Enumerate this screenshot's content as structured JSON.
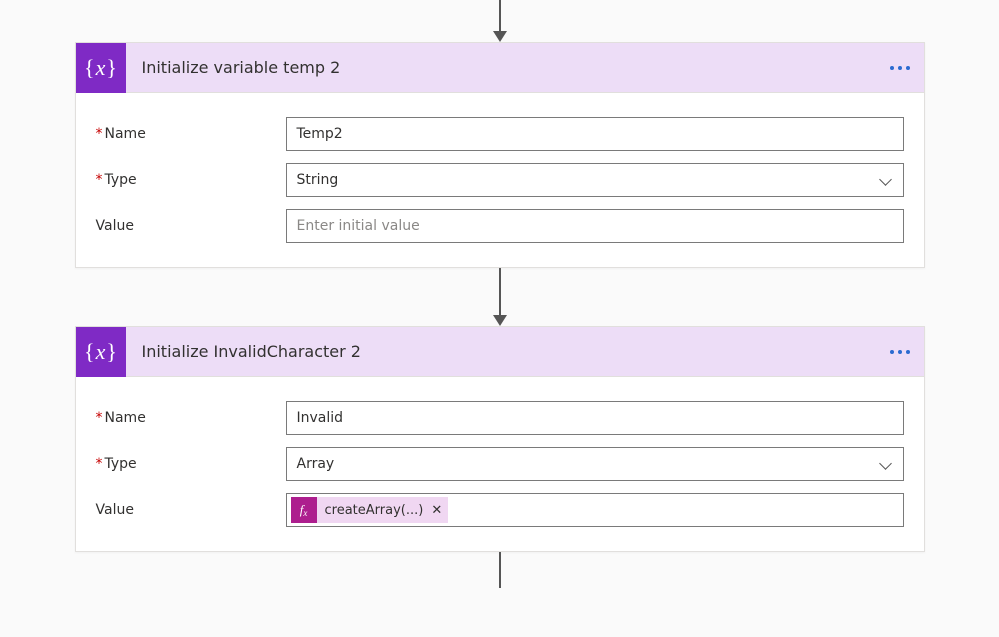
{
  "cards": [
    {
      "title": "Initialize variable temp 2",
      "fields": {
        "name_label": "Name",
        "name_value": "Temp2",
        "type_label": "Type",
        "type_value": "String",
        "value_label": "Value",
        "value_placeholder": "Enter initial value"
      }
    },
    {
      "title": "Initialize InvalidCharacter 2",
      "fields": {
        "name_label": "Name",
        "name_value": "Invalid",
        "type_label": "Type",
        "type_value": "Array",
        "value_label": "Value",
        "value_token": "createArray(...)"
      }
    }
  ],
  "asterisk": "*",
  "token_remove_glyph": "✕"
}
